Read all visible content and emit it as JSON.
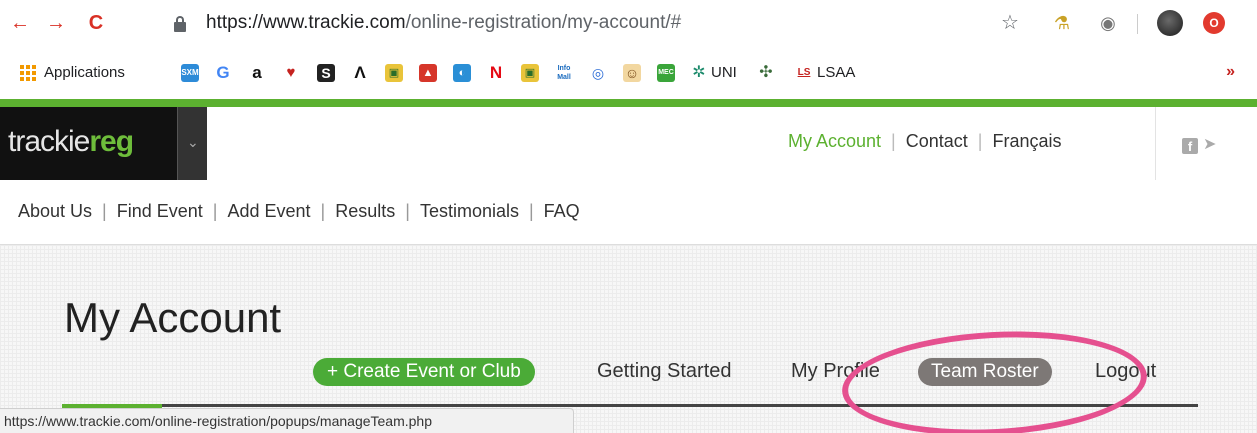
{
  "browser": {
    "url_host": "https://www.trackie.com",
    "url_path": "/online-registration/my-account/#"
  },
  "bookmarks": {
    "applications_label": "Applications",
    "uni_label": "UNI",
    "lsaa_label": "LSAA",
    "more_label": "»"
  },
  "site": {
    "logo_prefix": "trackie",
    "logo_suffix": "reg",
    "top_links": [
      "My Account",
      "Contact",
      "Français"
    ],
    "sub_nav": [
      "About Us",
      "Find Event",
      "Add Event",
      "Results",
      "Testimonials",
      "FAQ"
    ]
  },
  "account": {
    "title": "My Account",
    "create_label": "+ Create Event or Club",
    "getting_started_label": "Getting Started",
    "my_profile_label": "My Profile",
    "team_roster_label": "Team Roster",
    "logout_label": "Logout"
  },
  "status_url": "https://www.trackie.com/online-registration/popups/manageTeam.php",
  "colors": {
    "accent_green": "#5cb130",
    "button_green": "#4bab37",
    "team_roster_bg": "#7d7876",
    "annotation_pink": "#e5508f"
  }
}
